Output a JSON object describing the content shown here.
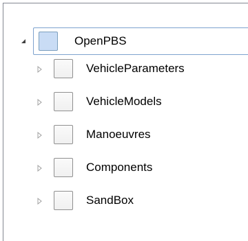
{
  "tree": {
    "root": {
      "label": "OpenPBS",
      "expanded": true,
      "expander_icon": "triangle-expanded-icon"
    },
    "children": [
      {
        "label": "VehicleParameters",
        "expander_icon": "triangle-collapsed-icon"
      },
      {
        "label": "VehicleModels",
        "expander_icon": "triangle-collapsed-icon"
      },
      {
        "label": "Manoeuvres",
        "expander_icon": "triangle-collapsed-icon"
      },
      {
        "label": "Components",
        "expander_icon": "triangle-collapsed-icon"
      },
      {
        "label": "SandBox",
        "expander_icon": "triangle-collapsed-icon"
      }
    ]
  },
  "colors": {
    "selection_border": "#7da2ce",
    "root_checkbox_fill": "#c9dcf5",
    "panel_border": "#828790"
  }
}
